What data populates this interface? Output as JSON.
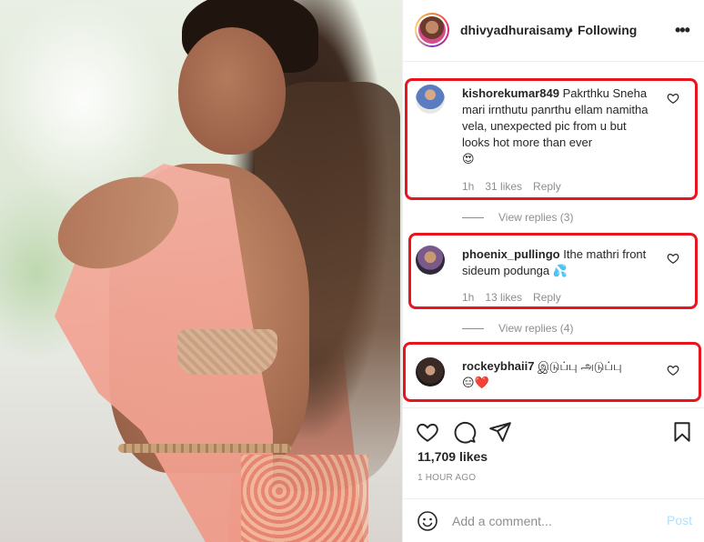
{
  "post": {
    "username": "dhivyadhuraisamy",
    "separator": "•",
    "follow_status": "Following",
    "more_icon": "more-horizontal-icon"
  },
  "comments": [
    {
      "username": "kishorekumar849",
      "text": "Pakrthku Sneha mari irnthutu panrthu ellam namitha vela, unexpected pic from u but looks hot more than ever",
      "emoji": "😍",
      "time": "1h",
      "likes": "31 likes",
      "reply": "Reply",
      "view_replies": "View replies (3)"
    },
    {
      "username": "phoenix_pullingo",
      "text": "Ithe mathri front sideum podunga",
      "emoji": "💦",
      "time": "1h",
      "likes": "13 likes",
      "reply": "Reply",
      "view_replies": "View replies (4)"
    },
    {
      "username": "rockeybhaii7",
      "text": "இடுப்பு அடுப்பு",
      "emoji": "😑❤️"
    }
  ],
  "actions": {
    "like_icon": "heart-icon",
    "comment_icon": "comment-icon",
    "share_icon": "paper-plane-icon",
    "save_icon": "bookmark-icon"
  },
  "likes_count": "11,709 likes",
  "timestamp": "1 HOUR AGO",
  "add_comment": {
    "placeholder": "Add a comment...",
    "post_label": "Post"
  },
  "colors": {
    "highlight_box": "#e8141e",
    "post_button": "#b2dffc",
    "muted_text": "#8e8e8e"
  }
}
